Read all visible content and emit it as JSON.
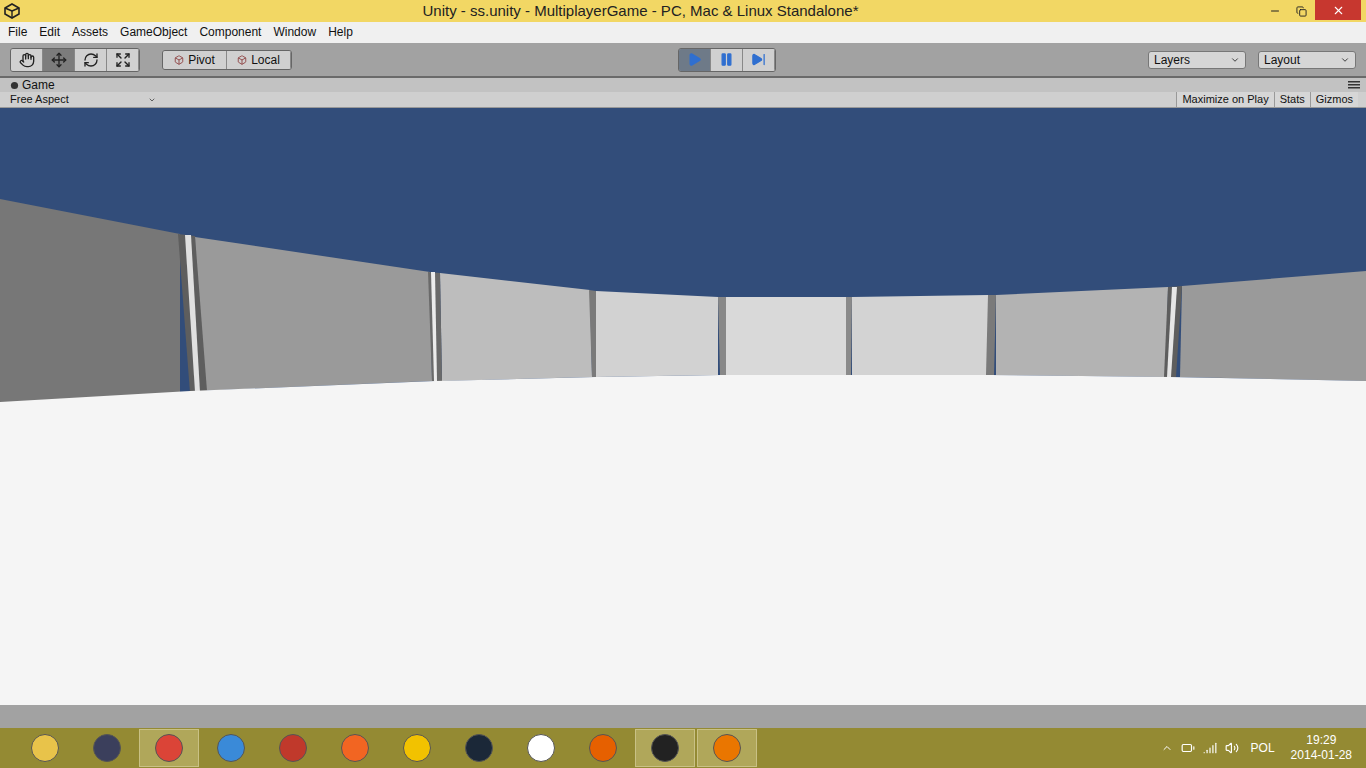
{
  "window": {
    "title": "Unity - ss.unity - MultiplayerGame - PC, Mac & Linux Standalone*"
  },
  "menu": [
    "File",
    "Edit",
    "Assets",
    "GameObject",
    "Component",
    "Window",
    "Help"
  ],
  "toolbar": {
    "tools": [
      {
        "kind": "hand",
        "selected": false
      },
      {
        "kind": "move",
        "selected": true
      },
      {
        "kind": "rotate",
        "selected": false
      },
      {
        "kind": "scale",
        "selected": false
      }
    ],
    "handle_buttons": [
      {
        "label": "Pivot"
      },
      {
        "label": "Local"
      }
    ],
    "playback": [
      {
        "kind": "play",
        "selected": true
      },
      {
        "kind": "pause",
        "selected": false
      },
      {
        "kind": "step",
        "selected": false
      }
    ],
    "dropdowns": [
      "Layers",
      "Layout"
    ]
  },
  "game_view": {
    "tab": "Game",
    "aspect": "Free Aspect",
    "toggles": [
      {
        "label": "Maximize on Play",
        "on": false
      },
      {
        "label": "Stats",
        "on": false
      },
      {
        "label": "Gizmos",
        "on": false
      }
    ]
  },
  "taskbar": {
    "apps": [
      {
        "selected": false,
        "color": "#e8c34a"
      },
      {
        "selected": false,
        "color": "#3b3f5c"
      },
      {
        "selected": true,
        "color": "#db4437"
      },
      {
        "selected": false,
        "color": "#3a8ad8"
      },
      {
        "selected": false,
        "color": "#c0392b"
      },
      {
        "selected": false,
        "color": "#f26522"
      },
      {
        "selected": false,
        "color": "#f2c200"
      },
      {
        "selected": false,
        "color": "#1b2838"
      },
      {
        "selected": false,
        "color": "#ffffff"
      },
      {
        "selected": false,
        "color": "#e66000"
      },
      {
        "selected": true,
        "color": "#222222"
      },
      {
        "selected": true,
        "color": "#ea7600"
      }
    ],
    "tray": {
      "language": "POL",
      "time": "19:29",
      "date": "2014-01-28"
    }
  }
}
